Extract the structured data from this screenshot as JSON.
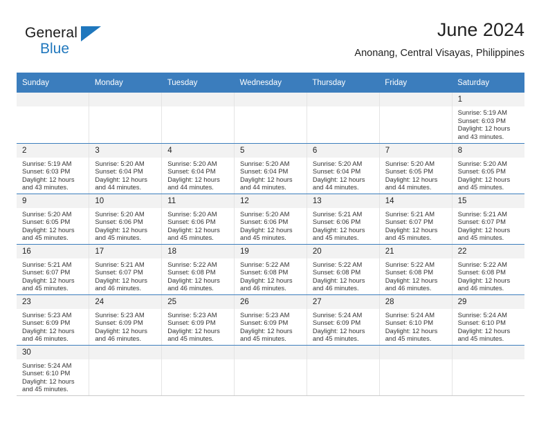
{
  "brand": {
    "name_part1": "General",
    "name_part2": "Blue",
    "flag_icon": "triangle-flag-icon",
    "accent_color": "#1f77bd"
  },
  "header": {
    "title": "June 2024",
    "subtitle": "Anonang, Central Visayas, Philippines"
  },
  "calendar": {
    "header_bg_color": "#3b7dbd",
    "daynum_bg_color": "#f2f2f2",
    "weekday_headers": [
      "Sunday",
      "Monday",
      "Tuesday",
      "Wednesday",
      "Thursday",
      "Friday",
      "Saturday"
    ],
    "labels": {
      "sunrise": "Sunrise:",
      "sunset": "Sunset:",
      "daylight": "Daylight:"
    },
    "weeks": [
      [
        {
          "day": "",
          "empty": true
        },
        {
          "day": "",
          "empty": true
        },
        {
          "day": "",
          "empty": true
        },
        {
          "day": "",
          "empty": true
        },
        {
          "day": "",
          "empty": true
        },
        {
          "day": "",
          "empty": true
        },
        {
          "day": "1",
          "sunrise": "Sunrise: 5:19 AM",
          "sunset": "Sunset: 6:03 PM",
          "daylight": "Daylight: 12 hours and 43 minutes."
        }
      ],
      [
        {
          "day": "2",
          "sunrise": "Sunrise: 5:19 AM",
          "sunset": "Sunset: 6:03 PM",
          "daylight": "Daylight: 12 hours and 43 minutes."
        },
        {
          "day": "3",
          "sunrise": "Sunrise: 5:20 AM",
          "sunset": "Sunset: 6:04 PM",
          "daylight": "Daylight: 12 hours and 44 minutes."
        },
        {
          "day": "4",
          "sunrise": "Sunrise: 5:20 AM",
          "sunset": "Sunset: 6:04 PM",
          "daylight": "Daylight: 12 hours and 44 minutes."
        },
        {
          "day": "5",
          "sunrise": "Sunrise: 5:20 AM",
          "sunset": "Sunset: 6:04 PM",
          "daylight": "Daylight: 12 hours and 44 minutes."
        },
        {
          "day": "6",
          "sunrise": "Sunrise: 5:20 AM",
          "sunset": "Sunset: 6:04 PM",
          "daylight": "Daylight: 12 hours and 44 minutes."
        },
        {
          "day": "7",
          "sunrise": "Sunrise: 5:20 AM",
          "sunset": "Sunset: 6:05 PM",
          "daylight": "Daylight: 12 hours and 44 minutes."
        },
        {
          "day": "8",
          "sunrise": "Sunrise: 5:20 AM",
          "sunset": "Sunset: 6:05 PM",
          "daylight": "Daylight: 12 hours and 45 minutes."
        }
      ],
      [
        {
          "day": "9",
          "sunrise": "Sunrise: 5:20 AM",
          "sunset": "Sunset: 6:05 PM",
          "daylight": "Daylight: 12 hours and 45 minutes."
        },
        {
          "day": "10",
          "sunrise": "Sunrise: 5:20 AM",
          "sunset": "Sunset: 6:06 PM",
          "daylight": "Daylight: 12 hours and 45 minutes."
        },
        {
          "day": "11",
          "sunrise": "Sunrise: 5:20 AM",
          "sunset": "Sunset: 6:06 PM",
          "daylight": "Daylight: 12 hours and 45 minutes."
        },
        {
          "day": "12",
          "sunrise": "Sunrise: 5:20 AM",
          "sunset": "Sunset: 6:06 PM",
          "daylight": "Daylight: 12 hours and 45 minutes."
        },
        {
          "day": "13",
          "sunrise": "Sunrise: 5:21 AM",
          "sunset": "Sunset: 6:06 PM",
          "daylight": "Daylight: 12 hours and 45 minutes."
        },
        {
          "day": "14",
          "sunrise": "Sunrise: 5:21 AM",
          "sunset": "Sunset: 6:07 PM",
          "daylight": "Daylight: 12 hours and 45 minutes."
        },
        {
          "day": "15",
          "sunrise": "Sunrise: 5:21 AM",
          "sunset": "Sunset: 6:07 PM",
          "daylight": "Daylight: 12 hours and 45 minutes."
        }
      ],
      [
        {
          "day": "16",
          "sunrise": "Sunrise: 5:21 AM",
          "sunset": "Sunset: 6:07 PM",
          "daylight": "Daylight: 12 hours and 45 minutes."
        },
        {
          "day": "17",
          "sunrise": "Sunrise: 5:21 AM",
          "sunset": "Sunset: 6:07 PM",
          "daylight": "Daylight: 12 hours and 46 minutes."
        },
        {
          "day": "18",
          "sunrise": "Sunrise: 5:22 AM",
          "sunset": "Sunset: 6:08 PM",
          "daylight": "Daylight: 12 hours and 46 minutes."
        },
        {
          "day": "19",
          "sunrise": "Sunrise: 5:22 AM",
          "sunset": "Sunset: 6:08 PM",
          "daylight": "Daylight: 12 hours and 46 minutes."
        },
        {
          "day": "20",
          "sunrise": "Sunrise: 5:22 AM",
          "sunset": "Sunset: 6:08 PM",
          "daylight": "Daylight: 12 hours and 46 minutes."
        },
        {
          "day": "21",
          "sunrise": "Sunrise: 5:22 AM",
          "sunset": "Sunset: 6:08 PM",
          "daylight": "Daylight: 12 hours and 46 minutes."
        },
        {
          "day": "22",
          "sunrise": "Sunrise: 5:22 AM",
          "sunset": "Sunset: 6:08 PM",
          "daylight": "Daylight: 12 hours and 46 minutes."
        }
      ],
      [
        {
          "day": "23",
          "sunrise": "Sunrise: 5:23 AM",
          "sunset": "Sunset: 6:09 PM",
          "daylight": "Daylight: 12 hours and 46 minutes."
        },
        {
          "day": "24",
          "sunrise": "Sunrise: 5:23 AM",
          "sunset": "Sunset: 6:09 PM",
          "daylight": "Daylight: 12 hours and 46 minutes."
        },
        {
          "day": "25",
          "sunrise": "Sunrise: 5:23 AM",
          "sunset": "Sunset: 6:09 PM",
          "daylight": "Daylight: 12 hours and 45 minutes."
        },
        {
          "day": "26",
          "sunrise": "Sunrise: 5:23 AM",
          "sunset": "Sunset: 6:09 PM",
          "daylight": "Daylight: 12 hours and 45 minutes."
        },
        {
          "day": "27",
          "sunrise": "Sunrise: 5:24 AM",
          "sunset": "Sunset: 6:09 PM",
          "daylight": "Daylight: 12 hours and 45 minutes."
        },
        {
          "day": "28",
          "sunrise": "Sunrise: 5:24 AM",
          "sunset": "Sunset: 6:10 PM",
          "daylight": "Daylight: 12 hours and 45 minutes."
        },
        {
          "day": "29",
          "sunrise": "Sunrise: 5:24 AM",
          "sunset": "Sunset: 6:10 PM",
          "daylight": "Daylight: 12 hours and 45 minutes."
        }
      ],
      [
        {
          "day": "30",
          "sunrise": "Sunrise: 5:24 AM",
          "sunset": "Sunset: 6:10 PM",
          "daylight": "Daylight: 12 hours and 45 minutes."
        },
        {
          "day": "",
          "empty": true
        },
        {
          "day": "",
          "empty": true
        },
        {
          "day": "",
          "empty": true
        },
        {
          "day": "",
          "empty": true
        },
        {
          "day": "",
          "empty": true
        },
        {
          "day": "",
          "empty": true
        }
      ]
    ]
  }
}
